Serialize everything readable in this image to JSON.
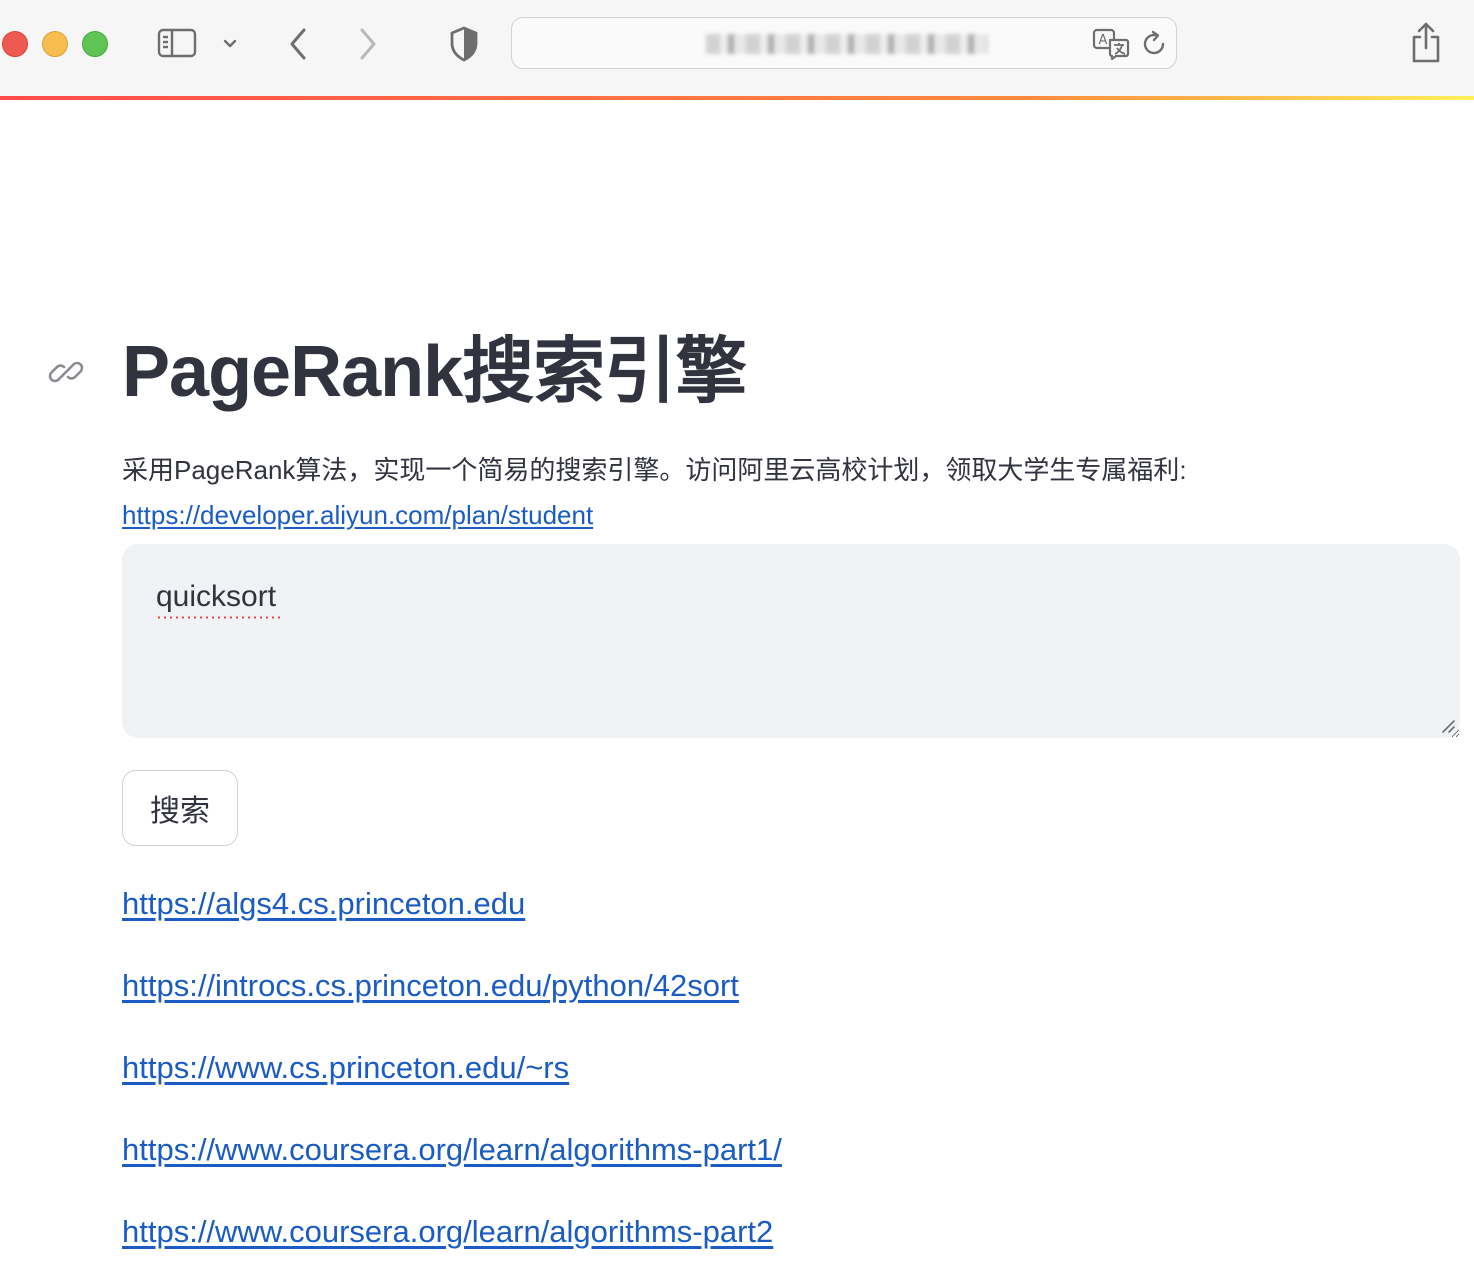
{
  "browser": {
    "address_bar": {
      "url_text": ""
    },
    "icons": {
      "sidebar": "sidebar-icon",
      "sidebar_menu": "chevron-down-icon",
      "back": "chevron-left-icon",
      "forward": "chevron-right-icon",
      "privacy": "shield-icon",
      "translate": "translate-icon",
      "reload": "reload-icon",
      "share": "share-icon"
    },
    "accent_gradient": [
      "#ff4b4b",
      "#ff8a3d",
      "#fff15a"
    ]
  },
  "page": {
    "anchor_icon": "link-icon",
    "title": "PageRank搜索引擎",
    "intro": "采用PageRank算法，实现一个简易的搜索引擎。访问阿里云高校计划，领取大学生专属福利:",
    "intro_link": "https://developer.aliyun.com/plan/student",
    "search": {
      "value": "quicksort",
      "placeholder": ""
    },
    "search_button": "搜索",
    "results": [
      "https://algs4.cs.princeton.edu",
      "https://introcs.cs.princeton.edu/python/42sort",
      "https://www.cs.princeton.edu/~rs",
      "https://www.coursera.org/learn/algorithms-part1/",
      "https://www.coursera.org/learn/algorithms-part2"
    ],
    "colors": {
      "text": "#31333f",
      "link": "#1a5cc4",
      "input_bg": "#f0f2f6"
    }
  }
}
